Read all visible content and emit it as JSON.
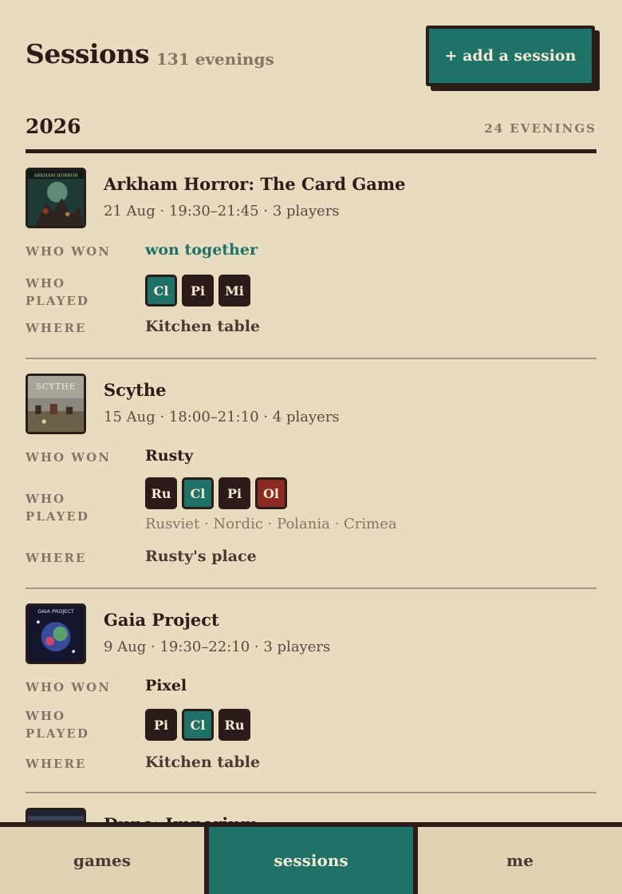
{
  "header": {
    "title": "Sessions",
    "count": "131 evenings",
    "add_label": "+ add a session"
  },
  "year": {
    "label": "2026",
    "evenings": "24 EVENINGS"
  },
  "labels": {
    "who_won": "WHO WON",
    "who_played": "WHO PLAYED",
    "where": "WHERE"
  },
  "sessions": [
    {
      "title": "Arkham Horror: The Card Game",
      "meta": "21 Aug · 19:30–21:45 · 3 players",
      "winner": "won together",
      "players": [
        "Cl",
        "Pi",
        "Mi"
      ],
      "where": "Kitchen table",
      "thumb_text": "ARKHAM HORROR"
    },
    {
      "title": "Scythe",
      "meta": "15 Aug · 18:00–21:10 · 4 players",
      "winner": "Rusty",
      "players": [
        "Ru",
        "Cl",
        "Pi",
        "Ol"
      ],
      "factions": "Rusviet · Nordic · Polania · Crimea",
      "where": "Rusty's place",
      "thumb_text": "SCYTHE"
    },
    {
      "title": "Gaia Project",
      "meta": "9 Aug · 19:30–22:10 · 3 players",
      "winner": "Pixel",
      "players": [
        "Pi",
        "Cl",
        "Ru"
      ],
      "where": "Kitchen table",
      "thumb_text": "GAIA PROJECT"
    },
    {
      "title": "Dune: Imperium"
    }
  ],
  "tabs": {
    "games": "games",
    "sessions": "sessions",
    "me": "me"
  },
  "colors": {
    "accent": "#1f7268",
    "ink": "#2a1c18",
    "paper": "#e8dcc0",
    "red_chip": "#8b2a20"
  },
  "icons": [
    "arkham-cover-icon",
    "scythe-cover-icon",
    "gaia-cover-icon",
    "dune-cover-icon"
  ]
}
